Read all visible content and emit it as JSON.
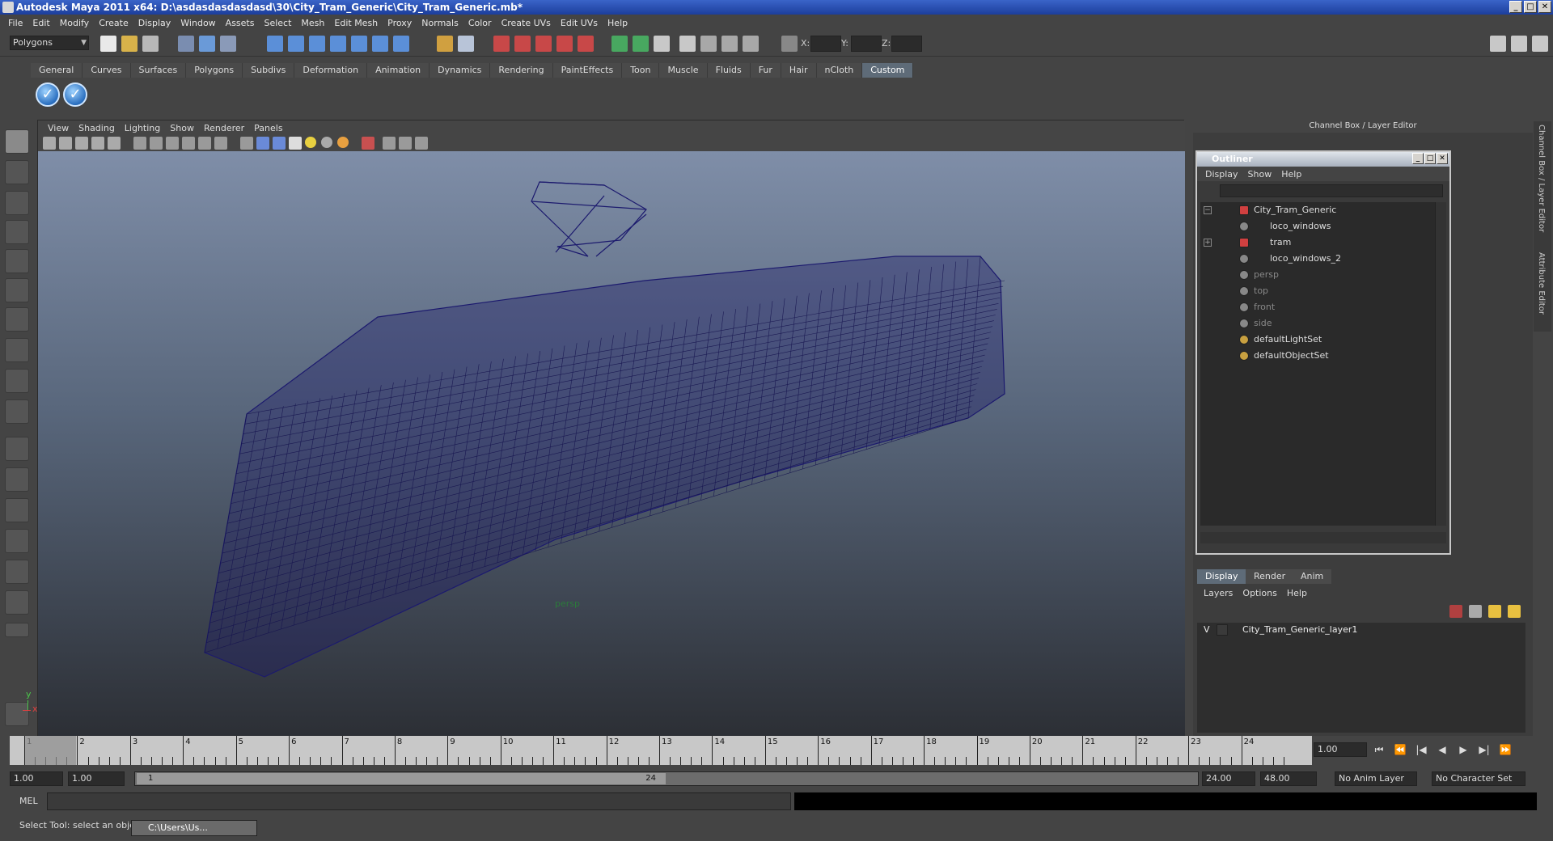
{
  "window": {
    "title": "Autodesk Maya 2011 x64: D:\\asdasdasdasdasd\\30\\City_Tram_Generic\\City_Tram_Generic.mb*",
    "controls": [
      "_",
      "□",
      "✕"
    ]
  },
  "menubar": [
    "File",
    "Edit",
    "Modify",
    "Create",
    "Display",
    "Window",
    "Assets",
    "Select",
    "Mesh",
    "Edit Mesh",
    "Proxy",
    "Normals",
    "Color",
    "Create UVs",
    "Edit UVs",
    "Help"
  ],
  "statusline": {
    "mode": "Polygons",
    "coords": [
      "X:",
      "Y:",
      "Z:"
    ]
  },
  "shelf": {
    "tabs": [
      "General",
      "Curves",
      "Surfaces",
      "Polygons",
      "Subdivs",
      "Deformation",
      "Animation",
      "Dynamics",
      "Rendering",
      "PaintEffects",
      "Toon",
      "Muscle",
      "Fluids",
      "Fur",
      "Hair",
      "nCloth",
      "Custom"
    ],
    "active_tab": "Custom",
    "buttons": [
      "check-icon",
      "check-icon"
    ]
  },
  "viewport": {
    "menu": [
      "View",
      "Shading",
      "Lighting",
      "Show",
      "Renderer",
      "Panels"
    ],
    "camera_label": "persp",
    "axis": {
      "x": "x",
      "y": "y"
    },
    "wire_color": "#1c1a6e"
  },
  "channel_box": {
    "title": "Channel Box / Layer Editor",
    "side_tabs": [
      "Channel Box / Layer Editor",
      "Attribute Editor"
    ]
  },
  "outliner": {
    "title": "Outliner",
    "menu": [
      "Display",
      "Show",
      "Help"
    ],
    "items": [
      {
        "label": "City_Tram_Generic",
        "indent": 0,
        "dim": false,
        "expand": "−"
      },
      {
        "label": "loco_windows",
        "indent": 1,
        "dim": false,
        "expand": ""
      },
      {
        "label": "tram",
        "indent": 1,
        "dim": false,
        "expand": "+"
      },
      {
        "label": "loco_windows_2",
        "indent": 1,
        "dim": false,
        "expand": ""
      },
      {
        "label": "persp",
        "indent": 0,
        "dim": true,
        "expand": ""
      },
      {
        "label": "top",
        "indent": 0,
        "dim": true,
        "expand": ""
      },
      {
        "label": "front",
        "indent": 0,
        "dim": true,
        "expand": ""
      },
      {
        "label": "side",
        "indent": 0,
        "dim": true,
        "expand": ""
      },
      {
        "label": "defaultLightSet",
        "indent": 0,
        "dim": false,
        "expand": ""
      },
      {
        "label": "defaultObjectSet",
        "indent": 0,
        "dim": false,
        "expand": ""
      }
    ]
  },
  "layer_editor": {
    "tabs": [
      "Display",
      "Render",
      "Anim"
    ],
    "active_tab": "Display",
    "menu": [
      "Layers",
      "Options",
      "Help"
    ],
    "layers": [
      {
        "visible": "V",
        "name": "City_Tram_Generic_layer1"
      }
    ]
  },
  "timeline": {
    "ticks": [
      "1",
      "2",
      "3",
      "4",
      "5",
      "6",
      "7",
      "8",
      "9",
      "10",
      "11",
      "12",
      "13",
      "14",
      "15",
      "16",
      "17",
      "18",
      "19",
      "20",
      "21",
      "22",
      "23",
      "24"
    ],
    "current_frame": "1.00",
    "playback": [
      "⏮",
      "⏪",
      "|◀",
      "◀",
      "▶",
      "▶|",
      "⏩"
    ]
  },
  "range": {
    "start": "1.00",
    "start2": "1.00",
    "handle_start": "1",
    "handle_end": "24",
    "end": "24.00",
    "end2": "48.00",
    "anim_layer": "No Anim Layer",
    "character_set": "No Character Set"
  },
  "command_line": {
    "label": "MEL"
  },
  "help_line": {
    "text": "Select Tool: select an object",
    "task": "C:\\Users\\Us..."
  }
}
